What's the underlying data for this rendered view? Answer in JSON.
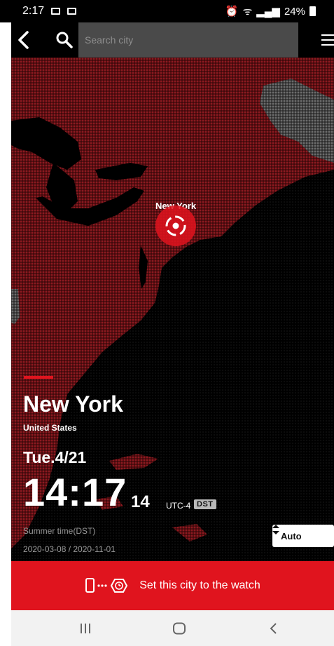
{
  "status_bar": {
    "time": "2:17",
    "battery": "24%",
    "icons": [
      "mail-icon",
      "image-icon",
      "alarm-icon",
      "wifi-icon",
      "signal-icon",
      "battery-icon"
    ]
  },
  "header": {
    "search_placeholder": "Search city",
    "icons": [
      "back-arrow-icon",
      "search-icon",
      "menu-icon"
    ]
  },
  "map": {
    "marker_label": "New York",
    "land_color": "#8c1a20",
    "foreign_land_color": "#6c6c6c",
    "water_color": "#000000"
  },
  "city": {
    "name": "New York",
    "country": "United States",
    "date": "Tue.4/21",
    "time": "14:17",
    "seconds": "14",
    "utc_offset": "UTC-4",
    "dst_badge": "DST",
    "dst_label": "Summer time(DST)",
    "dst_range": "2020-03-08 / 2020-11-01"
  },
  "mode_select": {
    "value": "Auto"
  },
  "action": {
    "label": "Set this city to the watch",
    "accent_color": "#e0141e"
  },
  "nav_bar": {
    "icons": [
      "recents-icon",
      "home-icon",
      "back-icon"
    ]
  }
}
